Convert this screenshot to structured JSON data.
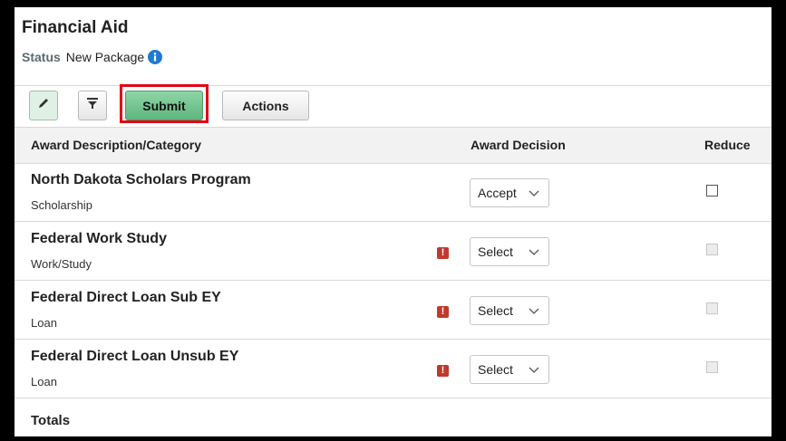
{
  "page": {
    "title": "Financial Aid",
    "status_label": "Status",
    "status_value": "New Package"
  },
  "toolbar": {
    "edit_icon": "pencil-icon",
    "filter_icon": "filter-icon",
    "submit_label": "Submit",
    "actions_label": "Actions",
    "highlight_color": "#e30613"
  },
  "table": {
    "headers": {
      "description": "Award Description/Category",
      "decision": "Award Decision",
      "reduce": "Reduce"
    },
    "rows": [
      {
        "name": "North Dakota Scholars Program",
        "category": "Scholarship",
        "decision": "Accept",
        "warning": false,
        "reduce_enabled": true
      },
      {
        "name": "Federal Work Study",
        "category": "Work/Study",
        "decision": "Select",
        "warning": true,
        "reduce_enabled": false
      },
      {
        "name": "Federal Direct Loan Sub EY",
        "category": "Loan",
        "decision": "Select",
        "warning": true,
        "reduce_enabled": false
      },
      {
        "name": "Federal Direct Loan Unsub EY",
        "category": "Loan",
        "decision": "Select",
        "warning": true,
        "reduce_enabled": false
      }
    ],
    "totals_label": "Totals"
  }
}
